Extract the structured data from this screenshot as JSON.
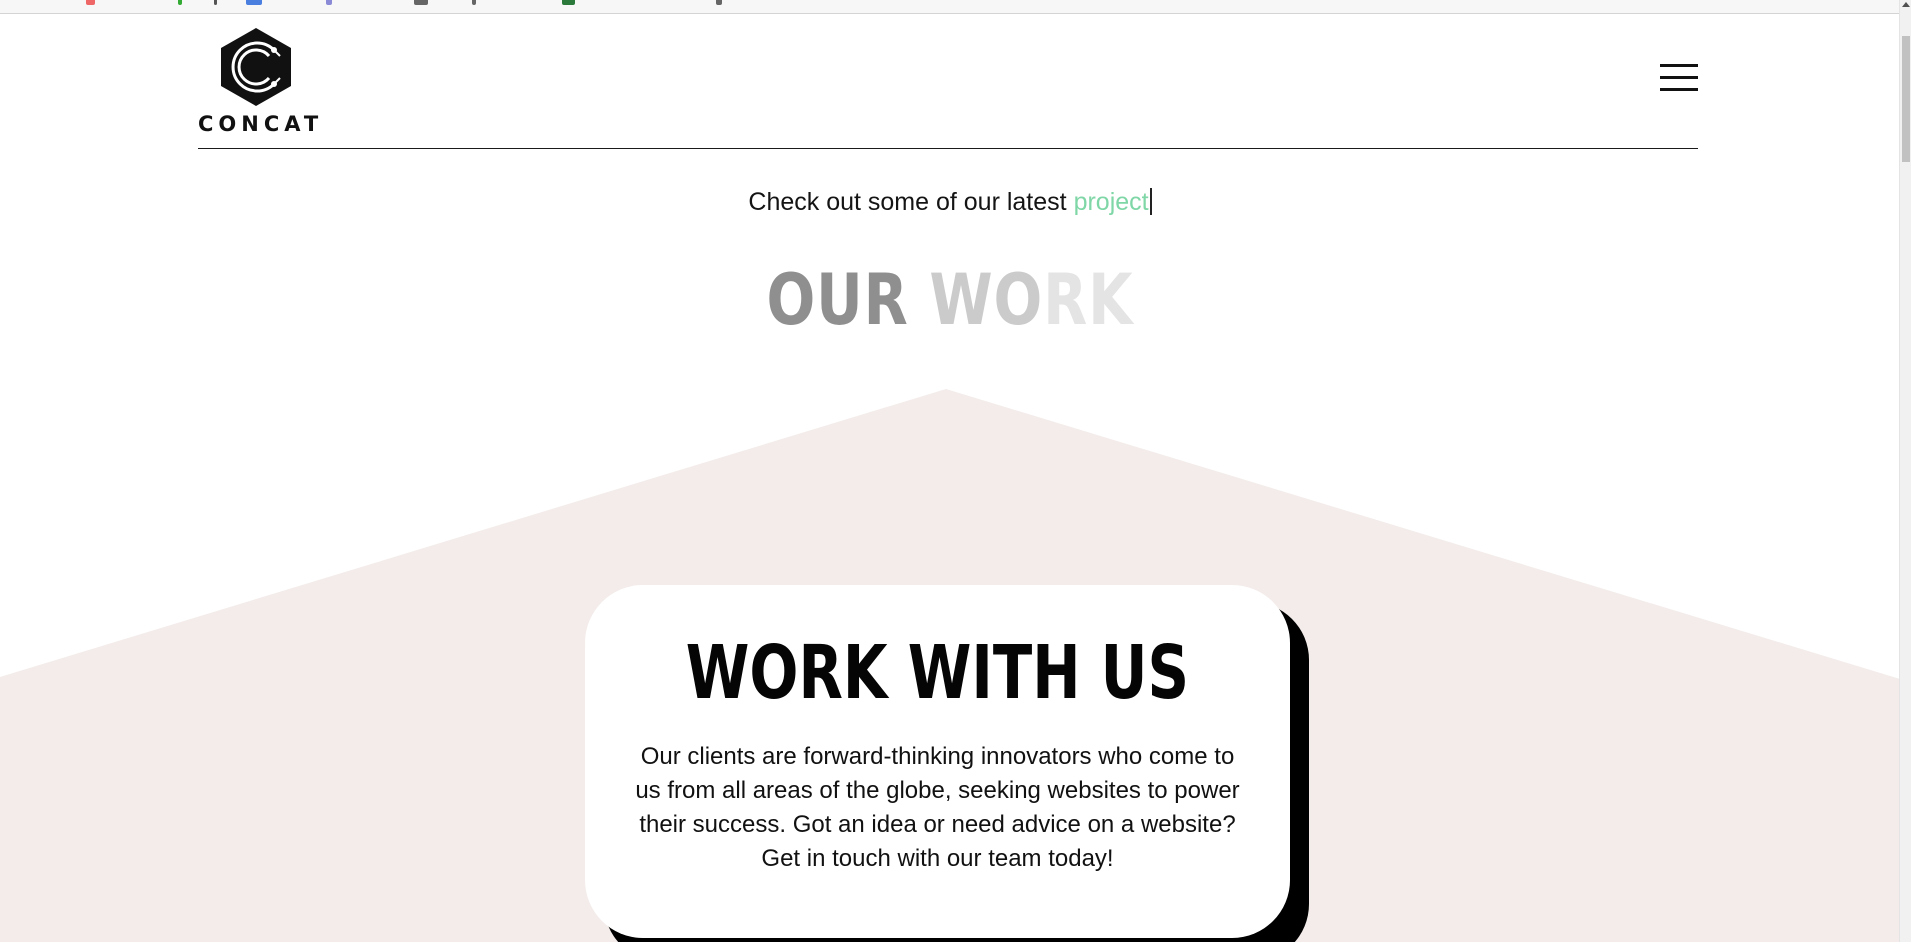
{
  "brand": {
    "name": "CONCAT",
    "logo_icon": "hexagon-c-logo-icon"
  },
  "header": {
    "menu_icon": "hamburger-menu-icon"
  },
  "hero": {
    "intro_prefix": "Check out some of our latest ",
    "intro_highlight": "project",
    "heading_word_1": "OUR ",
    "heading_word_2": "WO",
    "heading_word_3": "RK"
  },
  "cta_card": {
    "title": "WORK WITH US",
    "body": "Our clients are forward-thinking innovators who come to us from all areas of the globe, seeking websites to power their success. Got an idea or need advice on a website? Get in touch with our team today!"
  },
  "colors": {
    "accent_green": "#7fd6a6",
    "peak_background": "#f3ecea",
    "text_dark": "#111111",
    "card_shadow": "#000000"
  }
}
